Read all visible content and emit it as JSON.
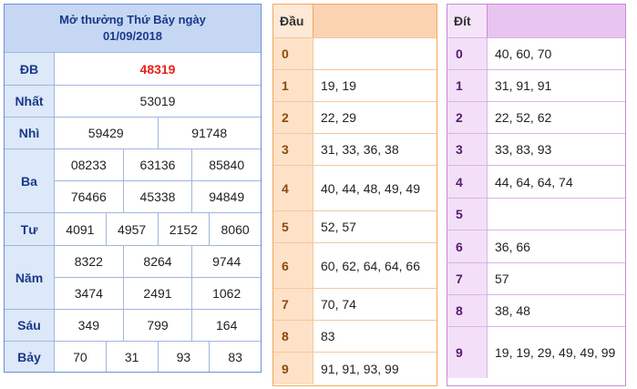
{
  "results": {
    "title_line1": "Mở thưởng Thứ Bảy ngày",
    "title_line2": "01/09/2018",
    "db": {
      "label": "ĐB",
      "values": [
        "48319"
      ]
    },
    "nhat": {
      "label": "Nhất",
      "values": [
        "53019"
      ]
    },
    "nhi": {
      "label": "Nhì",
      "values": [
        "59429",
        "91748"
      ]
    },
    "ba": {
      "label": "Ba",
      "rows": [
        [
          "08233",
          "63136",
          "85840"
        ],
        [
          "76466",
          "45338",
          "94849"
        ]
      ]
    },
    "tu": {
      "label": "Tư",
      "values": [
        "4091",
        "4957",
        "2152",
        "8060"
      ]
    },
    "nam": {
      "label": "Năm",
      "rows": [
        [
          "8322",
          "8264",
          "9744"
        ],
        [
          "3474",
          "2491",
          "1062"
        ]
      ]
    },
    "sau": {
      "label": "Sáu",
      "values": [
        "349",
        "799",
        "164"
      ]
    },
    "bay": {
      "label": "Bảy",
      "values": [
        "70",
        "31",
        "93",
        "83"
      ]
    }
  },
  "dau": {
    "header": "Đầu",
    "rows": [
      {
        "key": "0",
        "value": ""
      },
      {
        "key": "1",
        "value": "19, 19"
      },
      {
        "key": "2",
        "value": "22, 29"
      },
      {
        "key": "3",
        "value": "31, 33, 36, 38"
      },
      {
        "key": "4",
        "value": "40, 44, 48, 49, 49"
      },
      {
        "key": "5",
        "value": "52, 57"
      },
      {
        "key": "6",
        "value": "60, 62, 64, 64, 66"
      },
      {
        "key": "7",
        "value": "70, 74"
      },
      {
        "key": "8",
        "value": "83"
      },
      {
        "key": "9",
        "value": "91, 91, 93, 99"
      }
    ]
  },
  "dit": {
    "header": "Đít",
    "rows": [
      {
        "key": "0",
        "value": "40, 60, 70"
      },
      {
        "key": "1",
        "value": "31, 91, 91"
      },
      {
        "key": "2",
        "value": "22, 52, 62"
      },
      {
        "key": "3",
        "value": "33, 83, 93"
      },
      {
        "key": "4",
        "value": "44, 64, 64, 74"
      },
      {
        "key": "5",
        "value": ""
      },
      {
        "key": "6",
        "value": "36, 66"
      },
      {
        "key": "7",
        "value": "57"
      },
      {
        "key": "8",
        "value": "38, 48"
      },
      {
        "key": "9",
        "value": "19, 19, 29, 49, 49, 99"
      }
    ]
  },
  "colors": {
    "special_prize": "#e8201a",
    "results_header_bg": "#c5d7f2",
    "dau_header_bg": "#fbd3b1",
    "dit_header_bg": "#e8c4f1"
  }
}
